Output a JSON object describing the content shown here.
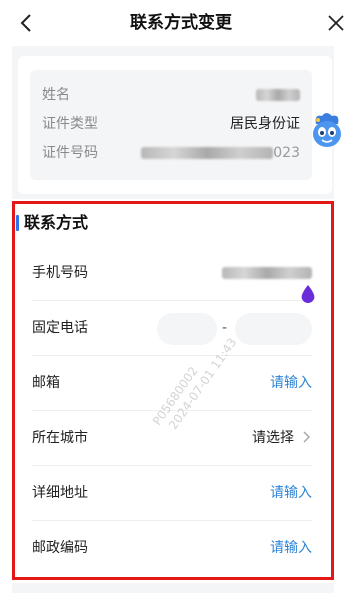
{
  "nav": {
    "title": "联系方式变更",
    "back_icon": "chevron-left-icon",
    "close_icon": "close-icon"
  },
  "identity": {
    "rows": [
      {
        "label": "姓名",
        "value": ""
      },
      {
        "label": "证件类型",
        "value": "居民身份证"
      },
      {
        "label": "证件号码",
        "value": "023"
      }
    ]
  },
  "contact": {
    "section_title": "联系方式",
    "mobile": {
      "label": "手机号码",
      "value": ""
    },
    "landline": {
      "label": "固定电话",
      "separator": "-"
    },
    "email": {
      "label": "邮箱",
      "value": "请输入"
    },
    "city": {
      "label": "所在城市",
      "value": "请选择"
    },
    "address": {
      "label": "详细地址",
      "value": "请输入"
    },
    "postcode": {
      "label": "邮政编码",
      "value": "请输入"
    }
  },
  "watermarks": {
    "id": "P05680002",
    "date": "2024-07-01 11:43"
  },
  "colors": {
    "accent": "#2f84d6",
    "highlight_frame": "#e21818",
    "page_bg": "#f4f5f7"
  }
}
